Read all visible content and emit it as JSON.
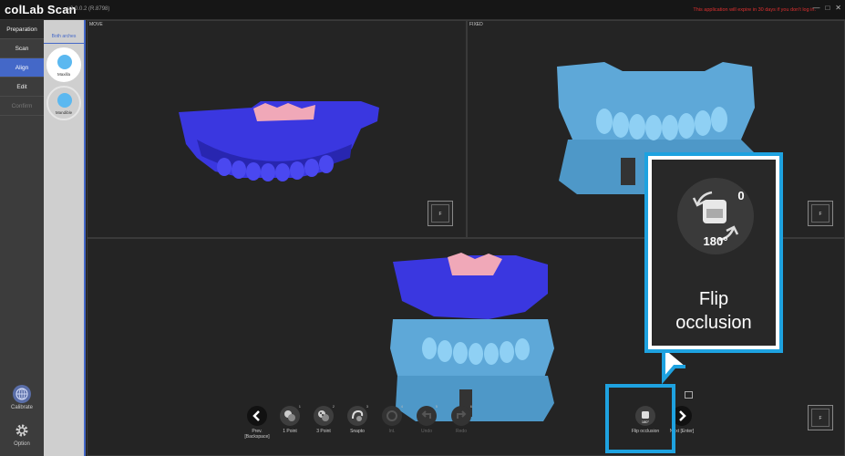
{
  "app": {
    "logo": "colLab Scan",
    "version": "v2.0.0.2 (R.8798)",
    "warning": "This application will expire in 30 days if you don't log in.",
    "window_buttons": [
      "—",
      "□",
      "✕"
    ]
  },
  "sidebar": {
    "items": [
      {
        "label": "Preparation",
        "state": "header"
      },
      {
        "label": "Scan",
        "state": "normal"
      },
      {
        "label": "Align",
        "state": "active"
      },
      {
        "label": "Edit",
        "state": "normal"
      },
      {
        "label": "Confirm",
        "state": "disabled"
      }
    ],
    "calibrate_label": "Calibrate",
    "option_label": "Option"
  },
  "subpanel": {
    "tab": "Both arches",
    "maxilla": "Maxilla",
    "mandible": "Mandible"
  },
  "viewports": {
    "move_label": "MOVE",
    "fixed_label": "FIXED",
    "fit_button": "F"
  },
  "toolbar": {
    "prev": "Prev. [Backspace]",
    "point1": "1 Point",
    "point3": "3 Point",
    "snapto": "Snapto",
    "init": "Int.",
    "undo": "Undo",
    "redo": "Redo",
    "flip": "Flip occlusion",
    "next": "Next [Enter]",
    "sup1": "1",
    "sup2": "2",
    "sup3": "3",
    "sup4": "4",
    "sup5": "5",
    "sup6": "6",
    "sup0": "0"
  },
  "callout": {
    "title_line1": "Flip",
    "title_line2": "occlusion",
    "icon_zero": "0",
    "icon_degree": "180°"
  },
  "colors": {
    "accent": "#1ea2e0",
    "active_tab": "#4468c8",
    "moving_model": "#3a37e0",
    "fixed_model": "#5ea8d8",
    "warning": "#e03030"
  }
}
